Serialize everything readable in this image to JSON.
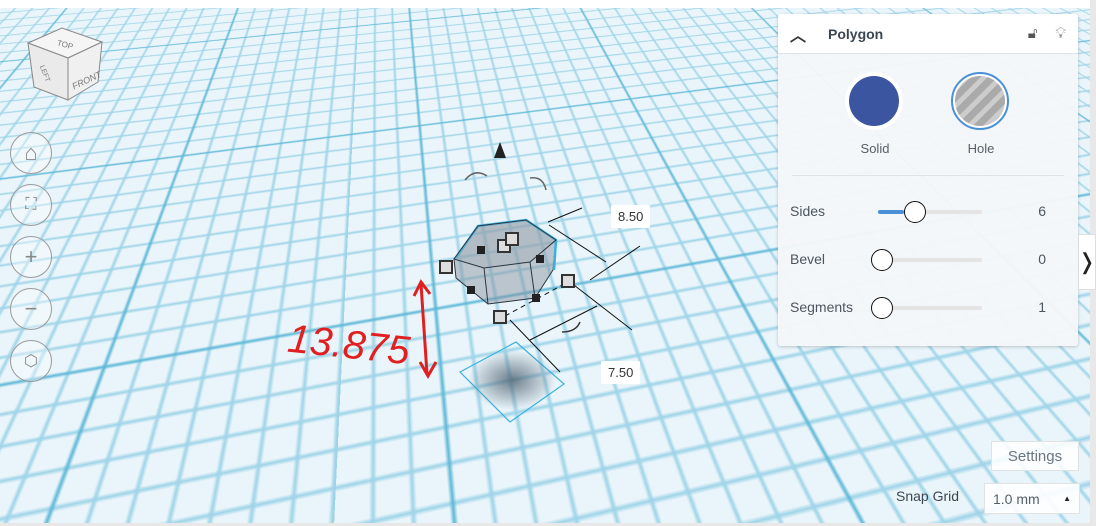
{
  "viewcube": {
    "top": "TOP",
    "left": "LEFT",
    "front": "FRONT"
  },
  "nav": [
    "home-view",
    "fit-view",
    "zoom-in",
    "zoom-out",
    "perspective-toggle"
  ],
  "dimensions": {
    "length": "8.50",
    "width": "7.50"
  },
  "annotation": {
    "text": "13.875"
  },
  "panel": {
    "title": "Polygon",
    "solid_label": "Solid",
    "hole_label": "Hole",
    "solid_color": "#3b55a0",
    "params": [
      {
        "label": "Sides",
        "value": "6",
        "fraction": 0.3
      },
      {
        "label": "Bevel",
        "value": "0",
        "fraction": 0
      },
      {
        "label": "Segments",
        "value": "1",
        "fraction": 0
      }
    ]
  },
  "footer": {
    "settings": "Settings",
    "snap_label": "Snap Grid",
    "snap_value": "1.0 mm"
  }
}
